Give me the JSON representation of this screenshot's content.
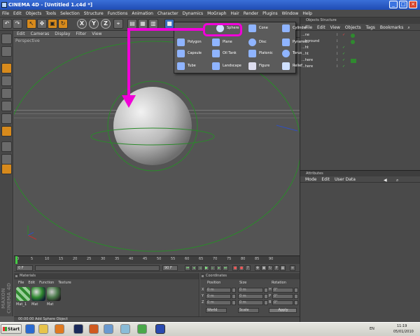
{
  "window": {
    "title": "CINEMA 4D - [Untitled 1.c4d *]",
    "minimize": "_",
    "maximize": "□",
    "close": "×"
  },
  "menu": [
    "File",
    "Edit",
    "Objects",
    "Tools",
    "Selection",
    "Structure",
    "Functions",
    "Animation",
    "Character",
    "Dynamics",
    "MoGraph",
    "Hair",
    "Render",
    "Plugins",
    "Window",
    "Help"
  ],
  "toolbar": {
    "x": "X",
    "y": "Y",
    "z": "Z"
  },
  "viewport": {
    "menu": [
      "Edit",
      "Cameras",
      "Display",
      "Filter",
      "View"
    ],
    "label": "Perspective"
  },
  "primitives": [
    {
      "label": "Sphere",
      "icon": "sphere-icon"
    },
    {
      "label": "Cone",
      "icon": "cone-icon"
    },
    {
      "label": "Cylinder",
      "icon": "cylinder-icon"
    },
    {
      "label": "Polygon",
      "icon": "polygon-icon"
    },
    {
      "label": "Plane",
      "icon": "plane-icon"
    },
    {
      "label": "Disc",
      "icon": "disc-icon"
    },
    {
      "label": "Pyramid",
      "icon": "pyramid-icon"
    },
    {
      "label": "Capsule",
      "icon": "capsule-icon"
    },
    {
      "label": "Oil Tank",
      "icon": "oiltank-icon"
    },
    {
      "label": "Platonic",
      "icon": "platonic-icon"
    },
    {
      "label": "Torus",
      "icon": "torus-icon"
    },
    {
      "label": "Tube",
      "icon": "tube-icon"
    },
    {
      "label": "Landscape",
      "icon": "landscape-icon"
    },
    {
      "label": "Figure",
      "icon": "figure-icon"
    },
    {
      "label": "Relief",
      "icon": "relief-icon"
    }
  ],
  "timeline": {
    "ticks": [
      "0",
      "5",
      "10",
      "15",
      "20",
      "25",
      "30",
      "35",
      "40",
      "45",
      "50",
      "55",
      "60",
      "65",
      "70",
      "75",
      "80",
      "85",
      "90"
    ],
    "start": "0 F",
    "end": "90 F"
  },
  "materials": {
    "title": "Materials",
    "menu": [
      "File",
      "Edit",
      "Function",
      "Texture"
    ],
    "items": [
      "Mat_1",
      "Mat",
      "Mat"
    ]
  },
  "coordinates": {
    "title": "Coordinates",
    "pos_header": "Position",
    "size_header": "Size",
    "rot_header": "Rotation",
    "rows": [
      {
        "axis": "X",
        "pos": "0 m",
        "size": "0 m",
        "rot_axis": "H",
        "rot": "0°"
      },
      {
        "axis": "Y",
        "pos": "0 m",
        "size": "0 m",
        "rot_axis": "P",
        "rot": "0°"
      },
      {
        "axis": "Z",
        "pos": "0 m",
        "size": "0 m",
        "rot_axis": "B",
        "rot": "0°"
      }
    ],
    "mode": "World",
    "scale": "Scale",
    "apply": "Apply"
  },
  "status": "00:00:00  Add Sphere Object",
  "brand": "MAXON CINEMA 4D",
  "object_manager": {
    "title": "Objects Structure",
    "menu": [
      "File",
      "Edit",
      "View",
      "Objects",
      "Tags",
      "Bookmarks"
    ],
    "objects": [
      "...ne",
      "...kground",
      "...ht",
      "...ht",
      "...here",
      "...here"
    ]
  },
  "attributes": {
    "title": "Attributes",
    "menu": [
      "Mode",
      "Edit",
      "User Data"
    ]
  },
  "taskbar": {
    "start": "Start",
    "lang": "EN",
    "time": "11:19",
    "date": "05/01/2010"
  },
  "colors": {
    "highlight": "#f000d8",
    "accent": "#d78a1c",
    "sphere_guide": "#2a8a2a",
    "mat_green": "#2f8a2f"
  }
}
